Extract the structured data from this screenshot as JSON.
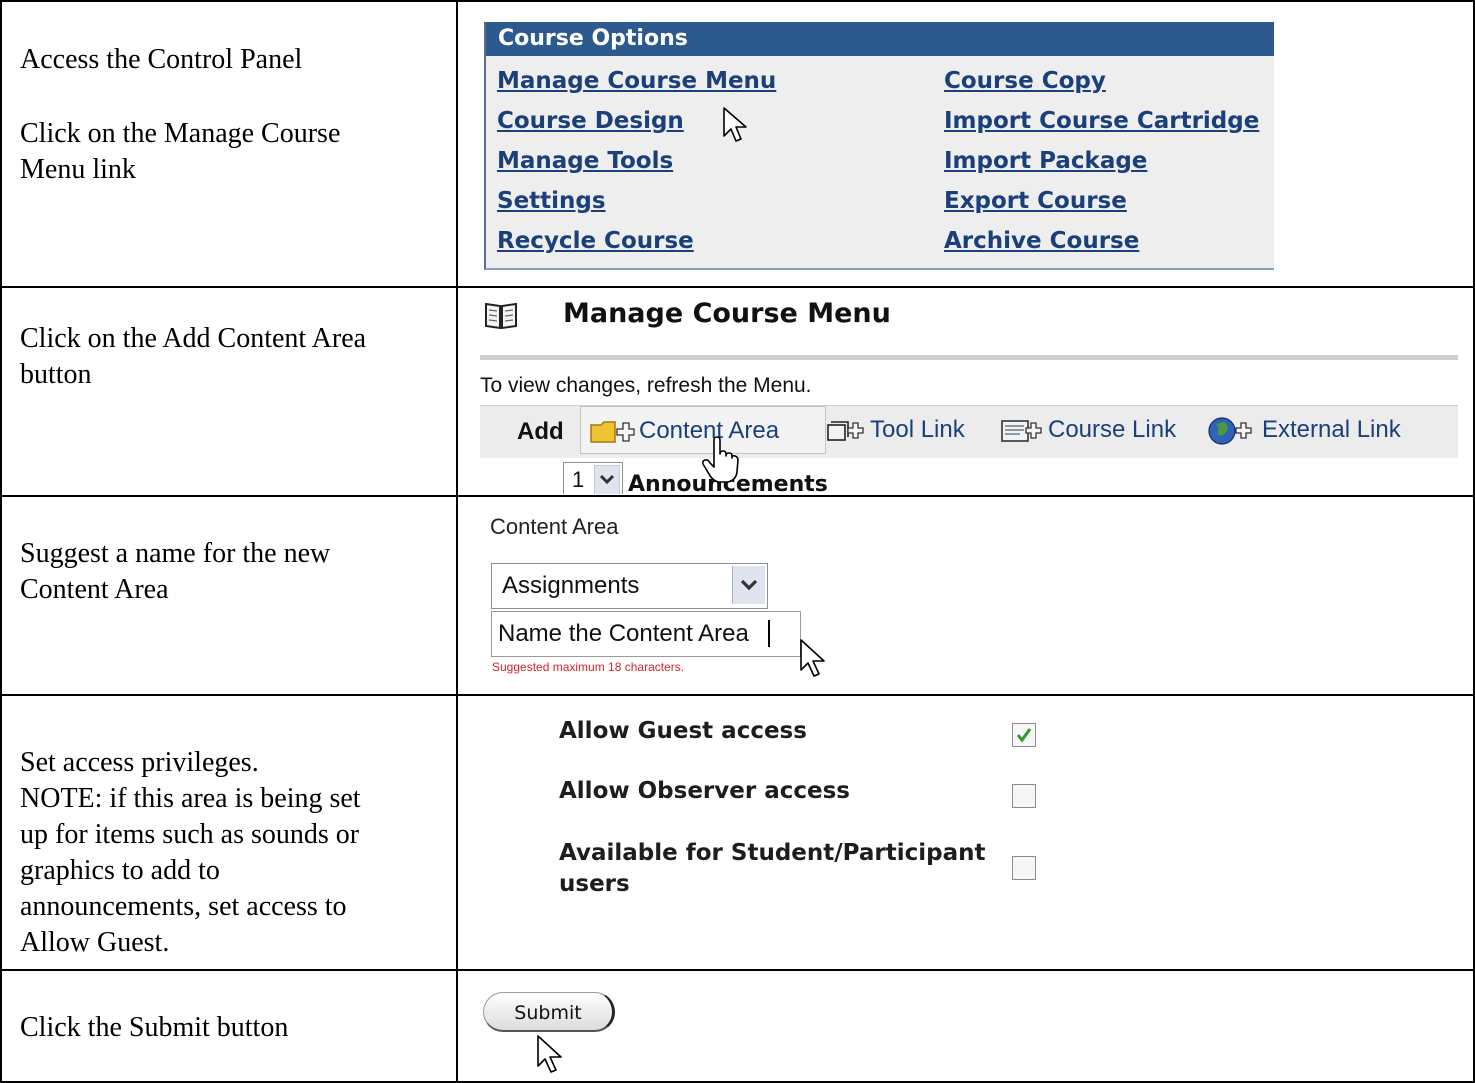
{
  "rows": [
    {
      "instruction_lines": [
        "Access the Control Panel",
        "",
        "Click on the Manage Course",
        "Menu link"
      ]
    },
    {
      "instruction_lines": [
        "Click on the Add Content Area",
        "button"
      ]
    },
    {
      "instruction_lines": [
        "Suggest a name for the new",
        "Content Area"
      ]
    },
    {
      "instruction_lines": [
        "Set access privileges.",
        "NOTE: if this area is being set",
        "up for items such as sounds or",
        "graphics to add to",
        "announcements, set access to",
        "Allow Guest."
      ]
    },
    {
      "instruction_lines": [
        "Click the Submit button"
      ]
    }
  ],
  "course_options": {
    "title": "Course Options",
    "col1": [
      "Manage Course Menu",
      "Course Design",
      "Manage Tools",
      "Settings",
      "Recycle Course"
    ],
    "col2": [
      "Course Copy",
      "Import Course Cartridge",
      "Import Package",
      "Export Course",
      "Archive Course"
    ]
  },
  "manage_menu": {
    "title": "Manage Course Menu",
    "note": "To view changes, refresh the Menu.",
    "add_label": "Add",
    "buttons": [
      "Content Area",
      "Tool Link",
      "Course Link",
      "External Link"
    ],
    "row_number": "1",
    "row_name": "Announcements"
  },
  "content_area": {
    "label": "Content Area",
    "selected": "Assignments",
    "input_value": "Name the Content Area",
    "hint": "Suggested maximum 18 characters."
  },
  "access": {
    "options": [
      {
        "label": "Allow Guest access",
        "checked": true
      },
      {
        "label": "Allow Observer access",
        "checked": false
      },
      {
        "label": "Available for Student/Participant users",
        "checked": false
      }
    ]
  },
  "submit": {
    "label": "Submit"
  },
  "colors": {
    "header_blue": "#2d5a8e",
    "link_blue": "#1a3f7a",
    "hint_red": "#d2232a",
    "check_green": "#2f9a2f"
  }
}
